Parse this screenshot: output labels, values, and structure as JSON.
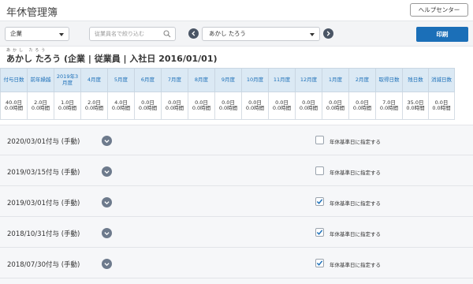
{
  "app": {
    "title": "年休管理簿",
    "help_label": "ヘルプセンター"
  },
  "toolbar": {
    "company_select": "企業",
    "search_placeholder": "従業員名で絞り込む",
    "employee_select": "あかし たろう",
    "print_label": "印刷"
  },
  "employee": {
    "ruby": "あかし たろう",
    "header": "あかし たろう (企業 | 従業員 | 入社日 2016/01/01)"
  },
  "leave_table": {
    "headers": [
      "付与日数",
      "前年繰越",
      "2019年3月度",
      "4月度",
      "5月度",
      "6月度",
      "7月度",
      "8月度",
      "9月度",
      "10月度",
      "11月度",
      "12月度",
      "1月度",
      "2月度",
      "取得日数",
      "残日数",
      "消滅日数"
    ],
    "values": [
      "40.0日\n0.0時間",
      "2.0日\n0.0時間",
      "1.0日\n0.0時間",
      "2.0日\n0.0時間",
      "4.0日\n0.0時間",
      "0.0日\n0.0時間",
      "0.0日\n0.0時間",
      "0.0日\n0.0時間",
      "0.0日\n0.0時間",
      "0.0日\n0.0時間",
      "0.0日\n0.0時間",
      "0.0日\n0.0時間",
      "0.0日\n0.0時間",
      "0.0日\n0.0時間",
      "7.0日\n0.0時間",
      "35.0日\n0.0時間",
      "0.0日\n0.0時間"
    ]
  },
  "grants": {
    "checkbox_label": "年休基準日に指定する",
    "items": [
      {
        "label": "2020/03/01付与 (手動)",
        "checked": false
      },
      {
        "label": "2019/03/15付与 (手動)",
        "checked": false
      },
      {
        "label": "2019/03/01付与 (手動)",
        "checked": true
      },
      {
        "label": "2018/10/31付与 (手動)",
        "checked": true
      },
      {
        "label": "2018/07/30付与 (手動)",
        "checked": true
      }
    ]
  },
  "colors": {
    "accent": "#1b6fb8",
    "header_bg": "#dbe9f4",
    "nav_circle": "#4a5565"
  },
  "icons": {
    "search": "search-icon",
    "prev": "chevron-left-icon",
    "next": "chevron-right-icon",
    "expand": "chevron-down-icon",
    "check": "check-icon"
  }
}
